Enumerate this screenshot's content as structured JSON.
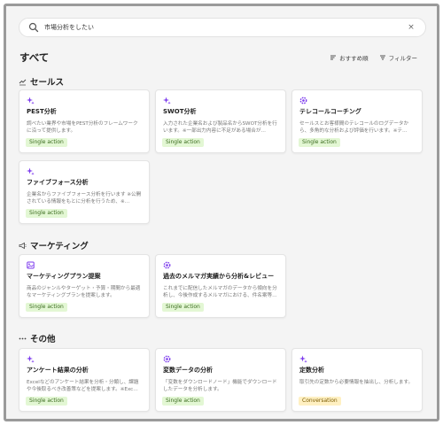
{
  "search": {
    "value": "市場分析をしたい",
    "placeholder": "市場分析をしたい",
    "clear_label": "×"
  },
  "page_title": "すべて",
  "controls": {
    "sort_label": "おすすめ順",
    "filter_label": "フィルター"
  },
  "colors": {
    "accent": "#7c3aed",
    "single_badge_bg": "#e3f7d4",
    "conversation_badge_bg": "#fff0c2"
  },
  "sections": [
    {
      "title": "セールス",
      "icon": "sales-icon",
      "cards": [
        {
          "title": "PEST分析",
          "desc": "調べたい業界や市場をPEST分析のフレームワークに沿って提供します。",
          "badge": "Single action",
          "icon": "sparkle-icon"
        },
        {
          "title": "SWOT分析",
          "desc": "入力された企業名および製品名からSWOT分析を行います。※一部出力内容に不足がある場合が…",
          "badge": "Single action",
          "icon": "sparkle-icon"
        },
        {
          "title": "テレコールコーチング",
          "desc": "セールスとお客様間のテレコールのログデータから、多角的な分析および評価を行います。※テ…",
          "badge": "Single action",
          "icon": "gear-sparkle-icon"
        },
        {
          "title": "ファイブフォース分析",
          "desc": "企業名からファイブフォース分析を行います ※公開されている情報をもとに分析を行うため、※…",
          "badge": "Single action",
          "icon": "sparkle-icon"
        }
      ]
    },
    {
      "title": "マーケティング",
      "icon": "megaphone-icon",
      "cards": [
        {
          "title": "マーケティングプラン提案",
          "desc": "商品のジャンルやターゲット・予算・期間から最適なマーケティングプランを提案します。",
          "badge": "Single action",
          "icon": "image-icon"
        },
        {
          "title": "過去のメルマガ実績から分析&レビュー",
          "desc": "これまでに配信したメルマガのデータから傾向を分析し、今後作成するメルマガにおける、件名案等…",
          "badge": "Single action",
          "icon": "gear-sparkle-icon"
        }
      ]
    },
    {
      "title": "その他",
      "icon": "more-icon",
      "cards": [
        {
          "title": "アンケート結果の分析",
          "desc": "Excelなどのアンケート結果を分析・分類し、課題や今後取るべき改善策などを提案します。※Exc…",
          "badge": "Single action",
          "icon": "sparkle-icon"
        },
        {
          "title": "変数データの分析",
          "desc": "「変数をダウンロードノード」機能でダウンロードしたデータを分析します。",
          "badge": "Single action",
          "icon": "gear-sparkle-icon"
        },
        {
          "title": "定数分析",
          "desc": "取引先の定数から必要情報を抽出し、分析します。",
          "badge": "Conversation",
          "icon": "sparkle-icon"
        }
      ]
    }
  ]
}
